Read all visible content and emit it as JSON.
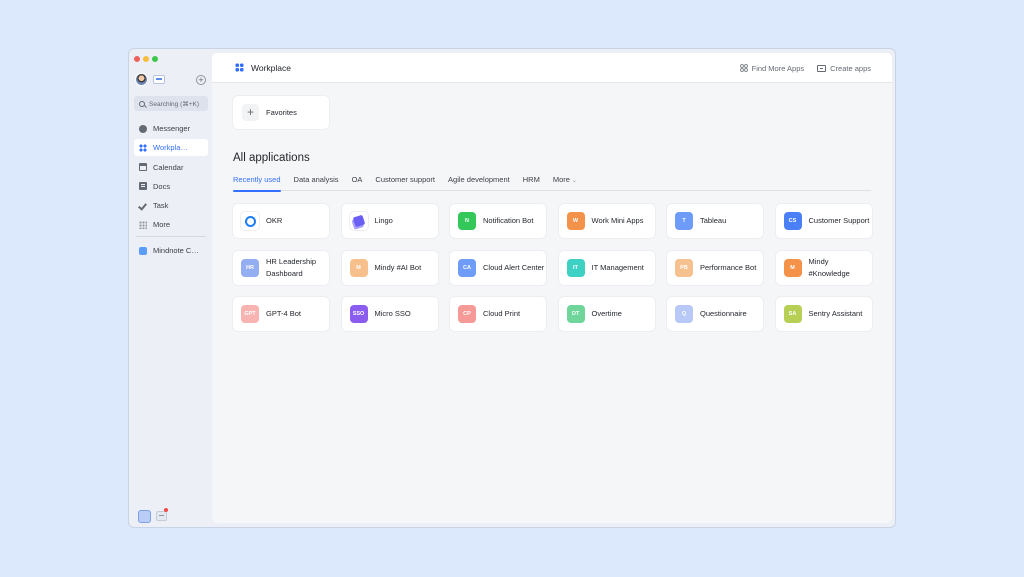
{
  "sidebar": {
    "search_placeholder": "Searching (⌘+K)",
    "items": [
      {
        "label": "Messenger",
        "icon": "chat-bubble-icon"
      },
      {
        "label": "Workplace",
        "icon": "grid-apps-icon",
        "display": "Workpla…",
        "active": true
      },
      {
        "label": "Calendar",
        "icon": "calendar-icon"
      },
      {
        "label": "Docs",
        "icon": "docs-icon"
      },
      {
        "label": "Task",
        "icon": "checkmark-icon"
      },
      {
        "label": "More",
        "icon": "more-grid-icon"
      }
    ],
    "pinned": {
      "label": "Mindnote C…",
      "icon": "mindnote-icon"
    }
  },
  "header": {
    "title": "Workplace",
    "find_more_apps": "Find More Apps",
    "create_apps": "Create apps"
  },
  "favorites": {
    "label": "Favorites"
  },
  "applications": {
    "title": "All applications",
    "tabs": [
      "Recently used",
      "Data analysis",
      "OA",
      "Customer support",
      "Agile development",
      "HRM",
      "More"
    ],
    "active_tab": "Recently used",
    "apps": [
      {
        "name": "OKR",
        "icon_text": "",
        "color": "#1f7cf5",
        "icon": "okr-target-icon"
      },
      {
        "name": "Lingo",
        "icon_text": "",
        "color": "#6b5ef5",
        "icon": "lingo-icon"
      },
      {
        "name": "Notification Bot",
        "icon_text": "N",
        "color": "#34c759"
      },
      {
        "name": "Work Mini Apps",
        "icon_text": "W",
        "color": "#f5924a"
      },
      {
        "name": "Tableau",
        "icon_text": "T",
        "color": "#6e9bf7"
      },
      {
        "name": "Customer Support",
        "icon_text": "CS",
        "color": "#4a7ff5"
      },
      {
        "name": "HR Leadership Dashboard",
        "icon_text": "HR",
        "color": "#93aef2"
      },
      {
        "name": "Mindy #AI Bot",
        "icon_text": "M",
        "color": "#f7bf8c"
      },
      {
        "name": "Cloud Alert Center",
        "icon_text": "CA",
        "color": "#6f9cf7"
      },
      {
        "name": "IT Management",
        "icon_text": "IT",
        "color": "#3ed0c2"
      },
      {
        "name": "Performance Bot",
        "icon_text": "PB",
        "color": "#f7c08f"
      },
      {
        "name": "Mindy #Knowledge",
        "icon_text": "M",
        "color": "#f5924a"
      },
      {
        "name": "GPT-4 Bot",
        "icon_text": "GPT",
        "color": "#f7b4b1"
      },
      {
        "name": "Micro SSO",
        "icon_text": "SSO",
        "color": "#8b5cf0"
      },
      {
        "name": "Cloud Print",
        "icon_text": "CP",
        "color": "#f59a96"
      },
      {
        "name": "Overtime",
        "icon_text": "OT",
        "color": "#6fd59a"
      },
      {
        "name": "Questionnaire",
        "icon_text": "Q",
        "color": "#b9c9f7"
      },
      {
        "name": "Sentry Assistant",
        "icon_text": "SA",
        "color": "#b6cf54"
      }
    ]
  }
}
